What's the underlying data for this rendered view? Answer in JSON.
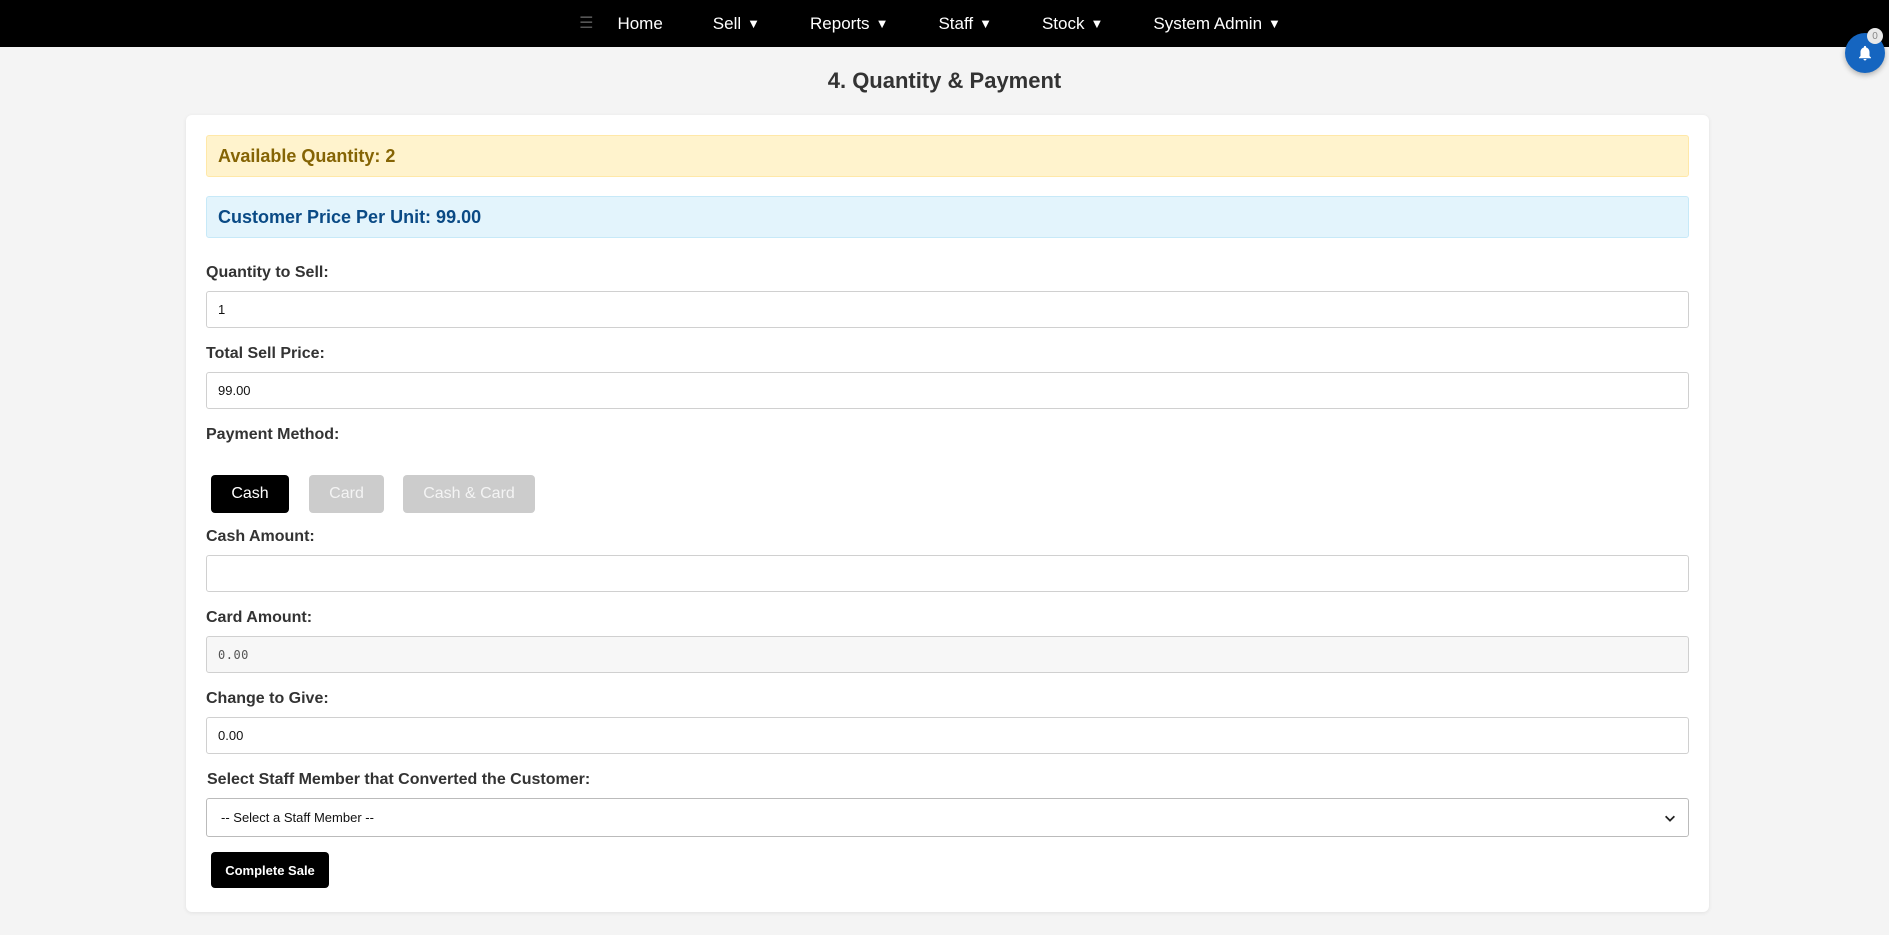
{
  "nav": {
    "menu_icon": "hamburger-icon",
    "items": [
      {
        "label": "Home",
        "caret": ""
      },
      {
        "label": "Sell",
        "caret": "▼"
      },
      {
        "label": "Reports",
        "caret": "▼"
      },
      {
        "label": "Staff",
        "caret": "▼"
      },
      {
        "label": "Stock",
        "caret": "▼"
      },
      {
        "label": "System Admin",
        "caret": "▼"
      }
    ]
  },
  "notifications": {
    "icon": "bell-icon",
    "count": "0",
    "color": "#1565c0"
  },
  "page": {
    "title": "4. Quantity & Payment"
  },
  "info": {
    "available_quantity": "Available Quantity: 2",
    "customer_price": "Customer Price Per Unit: 99.00"
  },
  "form": {
    "quantity": {
      "label": "Quantity to Sell:",
      "value": "1"
    },
    "total_price": {
      "label": "Total Sell Price:",
      "value": "99.00"
    },
    "payment_method": {
      "label": "Payment Method:",
      "options": [
        {
          "label": "Cash",
          "active": true
        },
        {
          "label": "Card",
          "active": false
        },
        {
          "label": "Cash & Card",
          "active": false
        }
      ]
    },
    "cash_amount": {
      "label": "Cash Amount:",
      "value": ""
    },
    "card_amount": {
      "label": "Card Amount:",
      "value": "0.00"
    },
    "change": {
      "label": "Change to Give:",
      "value": "0.00"
    },
    "staff": {
      "label": "Select Staff Member that Converted the Customer:",
      "selected": "-- Select a Staff Member --"
    },
    "submit_label": "Complete Sale"
  },
  "colors": {
    "nav_bg": "#000000",
    "info_warning_bg": "#fff3cd",
    "info_warning_text": "#856404",
    "info_blue_bg": "#e3f4fc",
    "info_blue_text": "#0a4a85",
    "active_button": "#000000",
    "inactive_button": "#cccccc"
  }
}
